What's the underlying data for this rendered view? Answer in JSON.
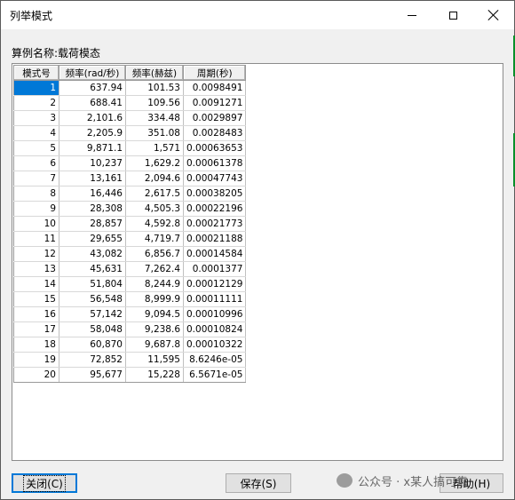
{
  "window": {
    "title": "列举模式"
  },
  "calc": {
    "label": "算例名称:载荷模态"
  },
  "table": {
    "headers": [
      "模式号",
      "频率(rad/秒)",
      "频率(赫兹)",
      "周期(秒)"
    ],
    "rows": [
      [
        "1",
        "637.94",
        "101.53",
        "0.0098491"
      ],
      [
        "2",
        "688.41",
        "109.56",
        "0.0091271"
      ],
      [
        "3",
        "2,101.6",
        "334.48",
        "0.0029897"
      ],
      [
        "4",
        "2,205.9",
        "351.08",
        "0.0028483"
      ],
      [
        "5",
        "9,871.1",
        "1,571",
        "0.00063653"
      ],
      [
        "6",
        "10,237",
        "1,629.2",
        "0.00061378"
      ],
      [
        "7",
        "13,161",
        "2,094.6",
        "0.00047743"
      ],
      [
        "8",
        "16,446",
        "2,617.5",
        "0.00038205"
      ],
      [
        "9",
        "28,308",
        "4,505.3",
        "0.00022196"
      ],
      [
        "10",
        "28,857",
        "4,592.8",
        "0.00021773"
      ],
      [
        "11",
        "29,655",
        "4,719.7",
        "0.00021188"
      ],
      [
        "12",
        "43,082",
        "6,856.7",
        "0.00014584"
      ],
      [
        "13",
        "45,631",
        "7,262.4",
        "0.0001377"
      ],
      [
        "14",
        "51,804",
        "8,244.9",
        "0.00012129"
      ],
      [
        "15",
        "56,548",
        "8,999.9",
        "0.00011111"
      ],
      [
        "16",
        "57,142",
        "9,094.5",
        "0.00010996"
      ],
      [
        "17",
        "58,048",
        "9,238.6",
        "0.00010824"
      ],
      [
        "18",
        "60,870",
        "9,687.8",
        "0.00010322"
      ],
      [
        "19",
        "72,852",
        "11,595",
        "8.6246e-05"
      ],
      [
        "20",
        "95,677",
        "15,228",
        "6.5671e-05"
      ]
    ],
    "selected_row": 0
  },
  "buttons": {
    "close": "关闭(C)",
    "save": "保存(S)",
    "help": "帮助(H)"
  },
  "watermark": {
    "text": "公众号 · x某人搞可靠"
  },
  "colors": {
    "selection": "#0078d7",
    "edge_accent": "#0a8f2a"
  }
}
